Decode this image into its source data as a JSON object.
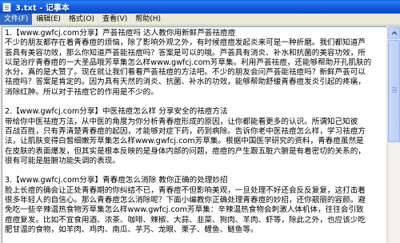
{
  "window": {
    "title": "3.txt - 记事本"
  },
  "menu": {
    "items": [
      {
        "label": "文件(F)",
        "state": "active"
      },
      {
        "label": "编辑(E)",
        "state": "normal"
      },
      {
        "label": "格式(O)",
        "state": "normal"
      },
      {
        "label": "查看(V)",
        "state": "normal"
      },
      {
        "label": "帮助(H)",
        "state": "normal"
      }
    ]
  },
  "document": {
    "lines": [
      "1.【www.gwfcj.com分享】芦荟祛痘吗 达人教你用新鲜芦荟祛痘痘",
      "不少的朋友都存在着青春痘的烦恼，除了影响外观之外，有时候痘痘发起炎来可是一种折磨。我们都知道芦",
      "荟具有美容功效，那么你知道芦荟能祛痘吗？答案是可以的哦。芦荟具有消炎、补水和抗菌的美容功效，所",
      "以是治疗青春痘的一大圣品哦芳草集怎么样www.gwfcj.com芳草集。利用芦荟祛痘，还能够帮助开孔肌肤的",
      "水分，真的是大赞了。现在就让我们看看芦荟祛痘的方法吧。不少的朋友会问芦荟能祛痘吗？新鲜芦荟可以",
      "祛痘吗？答案是肯定的。因为具有天然的消炎、抗菌、补水的功效，能够帮助舒缓青春痘发炎引起的疼痛，",
      "消除红肿。所以对于祛痘它的作用是不少的。",
      "",
      "2.【www.gwfcj.com分享】中医祛痘怎么样 分享安全的祛痘方法",
      "带给你中医祛痘方法，从中医的角度为你分析青春痘形成的原因，让你都能看更多的认识。所谓知己知彼",
      "百战百胜，只有弄清楚青春痘的起因，才能够对症下药，药到病除。告诉你老中医祛痘怎么样，学习祛痘方",
      "法，让肌肤变得白皙细嫩芳草集怎么样www.gwfcj.com芳草集。根据中国医学研究的资料，青春痘虽然是",
      "在皮肤的表面爆发，但其实是根本反映的是身体内部的问题，痘痘的产生跟五脏六腑是有着密切的关系的，",
      "很有可能是脏腑功能失调的表现。",
      "",
      "3.【www.gwfcj.com分享】青春痘怎么消除 教你正确的处理妙招",
      "脸上长痘的确会让正处青春期的你纠结不已，青春痘不但影响美观，一旦处理不好还会反反复复，这打击着",
      "很多年轻人的自信心。那么青春痘怎么消除呢？下面小编教你正确处理青春痘的妙招，还你靓丽的容颜。避",
      "免吃一些辛辣温热食物芳草集怎么样www.gwfcj.com芳草集：辛辣温热食物会刺激人体机体，往往会引致",
      "痘痘复发。比如不宜食用酒、浓茶、咖啡、辣椒、大蒜、韭菜、狗肉、羊肉、虾等，除此之外，也应该少吃",
      "肥甘温的食物，如羊肉、鸡肉、南瓜、芋艿、龙眼、栗子、鲤鱼、鲢鱼等。"
    ]
  },
  "scrollbar": {
    "position_fraction": 0.0,
    "visible_fraction": 0.47
  }
}
